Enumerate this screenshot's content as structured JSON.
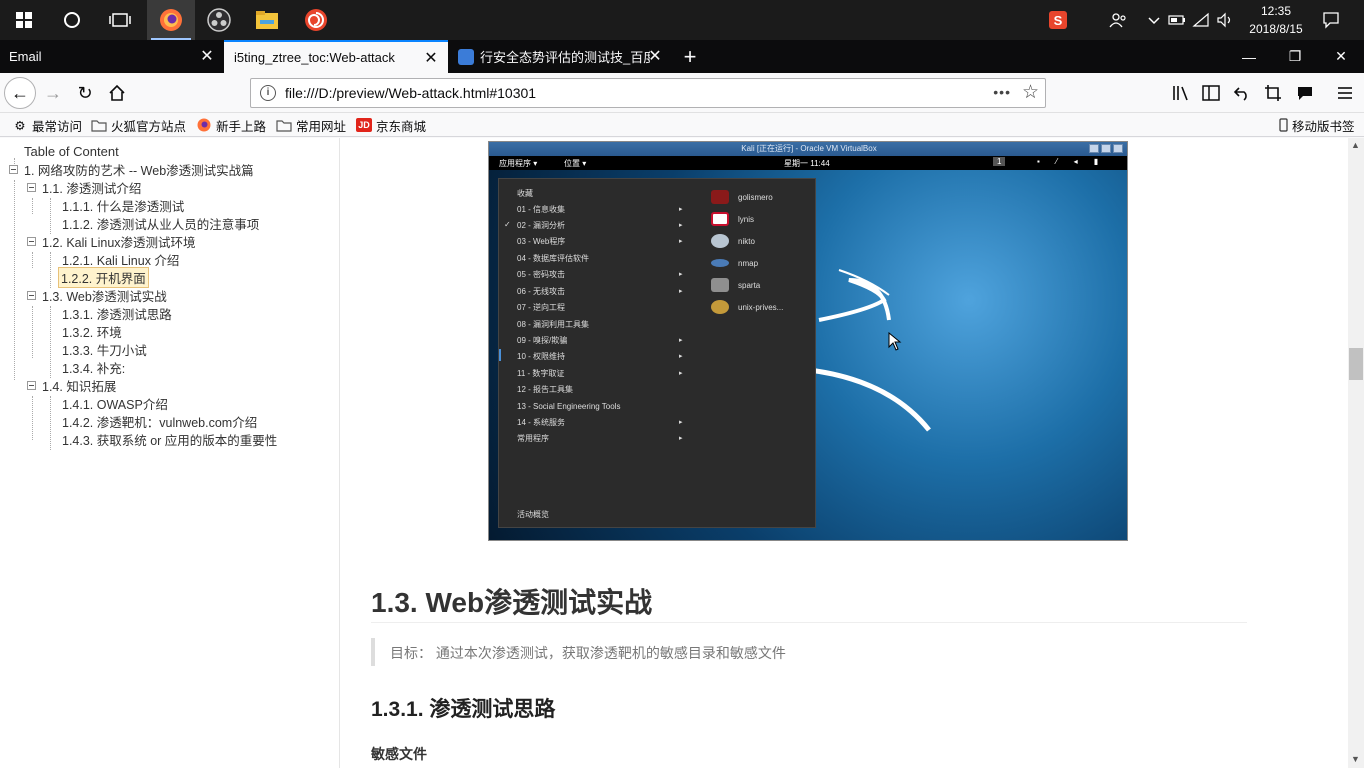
{
  "taskbar": {
    "start_icon": "windows-logo-icon",
    "search_icon": "cortana-circle-icon",
    "taskview_icon": "task-view-icon",
    "apps": [
      "firefox-icon",
      "obs-icon",
      "file-explorer-icon",
      "snail-app-icon"
    ],
    "tray": {
      "ime": "S",
      "time": "12:35",
      "date": "2018/8/15"
    }
  },
  "tabs": [
    {
      "label": "Email"
    },
    {
      "label": "i5ting_ztree_toc:Web-attack"
    },
    {
      "label": "行安全态势评估的测试技_百度"
    }
  ],
  "nav": {
    "url": "file:///D:/preview/Web-attack.html#10301",
    "more_label": "•••"
  },
  "bookmarks": {
    "items": [
      {
        "label": "最常访问"
      },
      {
        "label": "火狐官方站点"
      },
      {
        "label": "新手上路"
      },
      {
        "label": "常用网址"
      },
      {
        "label": "京东商城"
      }
    ],
    "mobile": "移动版书签"
  },
  "toc": {
    "header": "Table of Content",
    "items": [
      {
        "label": "1. 网络攻防的艺术 -- Web渗透测试实战篇"
      },
      {
        "label": "1.1. 渗透测试介绍"
      },
      {
        "label": "1.1.1. 什么是渗透测试"
      },
      {
        "label": "1.1.2. 渗透测试从业人员的注意事项"
      },
      {
        "label": "1.2. Kali Linux渗透测试环境"
      },
      {
        "label": "1.2.1. Kali Linux 介绍"
      },
      {
        "label": "1.2.2. 开机界面"
      },
      {
        "label": "1.3. Web渗透测试实战"
      },
      {
        "label": "1.3.1. 渗透测试思路"
      },
      {
        "label": "1.3.2. 环境"
      },
      {
        "label": "1.3.3. 牛刀小试"
      },
      {
        "label": "1.3.4. 补充:"
      },
      {
        "label": "1.4. 知识拓展"
      },
      {
        "label": "1.4.1. OWASP介绍"
      },
      {
        "label": "1.4.2. 渗透靶机：vulnweb.com介绍"
      },
      {
        "label": "1.4.3. 获取系统 or 应用的版本的重要性"
      }
    ]
  },
  "vm": {
    "title": "Kali [正在运行] - Oracle VM VirtualBox",
    "topbar": {
      "apps": "应用程序 ▾",
      "places": "位置 ▾",
      "clock": "星期一 11:44",
      "workspace": "1"
    },
    "menu": {
      "items": [
        {
          "label": "收藏",
          "arrow": ""
        },
        {
          "label": "01 - 信息收集",
          "arrow": "▸"
        },
        {
          "label": "02 - 漏洞分析",
          "arrow": "▸"
        },
        {
          "label": "03 - Web程序",
          "arrow": "▸"
        },
        {
          "label": "04 - 数据库评估软件",
          "arrow": ""
        },
        {
          "label": "05 - 密码攻击",
          "arrow": "▸"
        },
        {
          "label": "06 - 无线攻击",
          "arrow": "▸"
        },
        {
          "label": "07 - 逆向工程",
          "arrow": ""
        },
        {
          "label": "08 - 漏洞利用工具集",
          "arrow": ""
        },
        {
          "label": "09 - 嗅探/欺骗",
          "arrow": "▸"
        },
        {
          "label": "10 - 权限维持",
          "arrow": "▸"
        },
        {
          "label": "11 - 数字取证",
          "arrow": "▸"
        },
        {
          "label": "12 - 报告工具集",
          "arrow": ""
        },
        {
          "label": "13 - Social Engineering Tools",
          "arrow": ""
        },
        {
          "label": "14 - 系统服务",
          "arrow": "▸"
        },
        {
          "label": "常用程序",
          "arrow": "▸"
        }
      ],
      "footer": "活动概览",
      "apps": [
        {
          "label": "golismero",
          "color": "#8a1a1a"
        },
        {
          "label": "lynis",
          "color": "#c8102e"
        },
        {
          "label": "nikto",
          "color": "#b9c6d2"
        },
        {
          "label": "nmap",
          "color": "#4a7bb7"
        },
        {
          "label": "sparta",
          "color": "#8f8f8f"
        },
        {
          "label": "unix-prives...",
          "color": "#c49a3a"
        }
      ]
    }
  },
  "article": {
    "h2": "1.3. Web渗透测试实战",
    "quote": "目标： 通过本次渗透测试，获取渗透靶机的敏感目录和敏感文件",
    "h3": "1.3.1. 渗透测试思路",
    "bold": "敏感文件"
  }
}
